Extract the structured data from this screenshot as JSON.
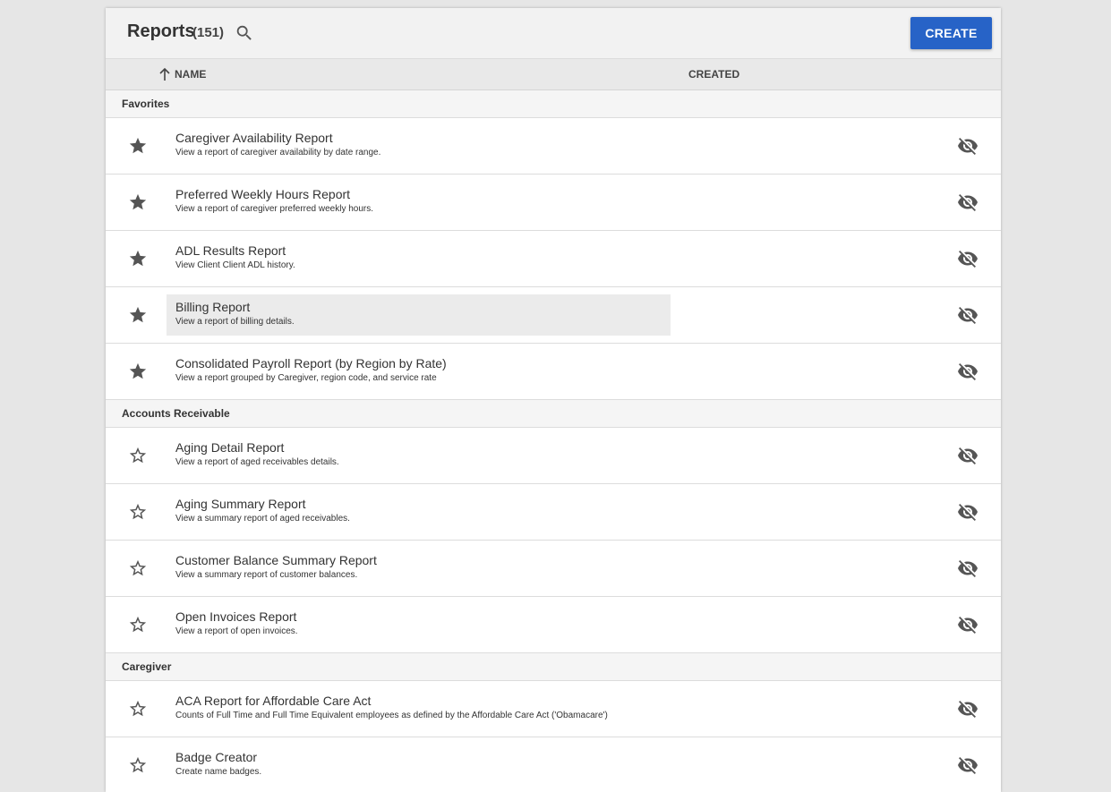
{
  "header": {
    "title": "Reports",
    "count": "(151)",
    "search_icon": "search-icon",
    "create_label": "CREATE",
    "accent_color": "#2763c7"
  },
  "columns": {
    "sort_icon": "arrow-up-icon",
    "name": "NAME",
    "created": "CREATED"
  },
  "groups": [
    {
      "label": "Favorites",
      "rows": [
        {
          "name": "Caregiver Availability Report",
          "desc": "View a report of caregiver availability by date range.",
          "favorite": true
        },
        {
          "name": "Preferred Weekly Hours Report",
          "desc": "View a report of caregiver preferred weekly hours.",
          "favorite": true
        },
        {
          "name": "ADL Results Report",
          "desc": "View Client Client ADL history.",
          "favorite": true
        },
        {
          "name": "Billing Report",
          "desc": "View a report of billing details.",
          "favorite": true,
          "hovered": true
        },
        {
          "name": "Consolidated Payroll Report (by Region by Rate)",
          "desc": "View a report grouped by Caregiver, region code, and service rate",
          "favorite": true
        }
      ]
    },
    {
      "label": "Accounts Receivable",
      "rows": [
        {
          "name": "Aging Detail Report",
          "desc": "View a report of aged receivables details.",
          "favorite": false
        },
        {
          "name": "Aging Summary Report",
          "desc": "View a summary report of aged receivables.",
          "favorite": false
        },
        {
          "name": "Customer Balance Summary Report",
          "desc": "View a summary report of customer balances.",
          "favorite": false
        },
        {
          "name": "Open Invoices Report",
          "desc": "View a report of open invoices.",
          "favorite": false
        }
      ]
    },
    {
      "label": "Caregiver",
      "rows": [
        {
          "name": "ACA Report for Affordable Care Act",
          "desc": "Counts of Full Time and Full Time Equivalent employees as defined by the Affordable Care Act ('Obamacare')",
          "favorite": false
        },
        {
          "name": "Badge Creator",
          "desc": "Create name badges.",
          "favorite": false
        }
      ]
    }
  ],
  "icons": {
    "favorite_on": "star-filled-icon",
    "favorite_off": "star-outline-icon",
    "hide": "eye-off-icon"
  }
}
